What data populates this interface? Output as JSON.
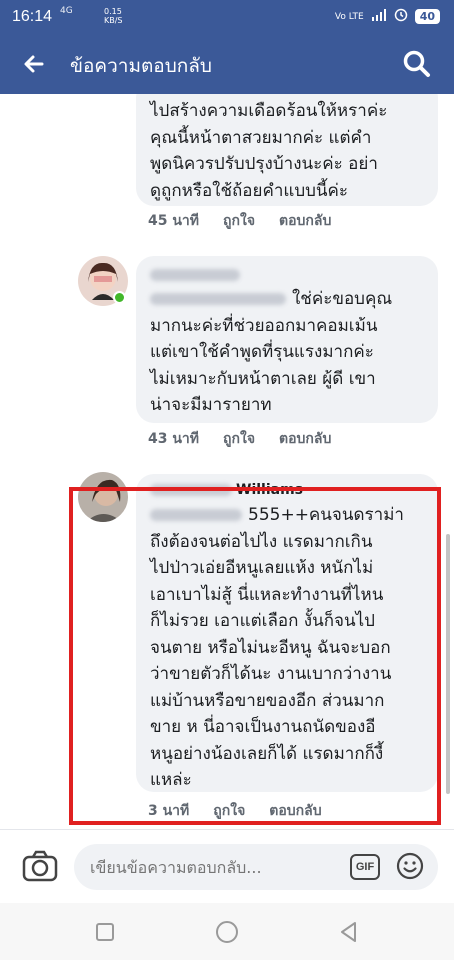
{
  "status": {
    "time": "16:14",
    "network": "4G",
    "speed_value": "0.15",
    "speed_unit": "KB/S",
    "volte": "Vo LTE",
    "battery": "40"
  },
  "header": {
    "title": "ข้อความตอบกลับ"
  },
  "comments": [
    {
      "text": "ไปสร้างความเดือดร้อนให้หราค่ะ\nคุณนี้หน้าตาสวยมากค่ะ แต่คำ\nพูดนิควรปรับปรุงบ้างนะค่ะ อย่า\nดูถูกหรือใช้ถ้อยคำแบบนี้ค่ะ",
      "time": "45 นาที",
      "like": "ถูกใจ",
      "reply": "ตอบกลับ"
    },
    {
      "text": "ใช่ค่ะขอบคุณ\nมากนะค่ะที่ช่วยออกมาคอมเม้น\nแต่เขาใช้คำพูดที่รุนแรงมากค่ะ\nไม่เหมาะกับหน้าตาเลย  ผู้ดี เขา\nน่าจะมีมารายาท",
      "time": "43 นาที",
      "like": "ถูกใจ",
      "reply": "ตอบกลับ"
    },
    {
      "name_suffix": "Williams",
      "text": "555++คนจนดราม่า\nถึงต้องจนต่อไปไง  แรดมากเกิน\nไปป่าวเอ่ยอีหนูเลยแห้ง หนักไม่\nเอาเบาไม่สู้ นี่แหละทำงานที่ไหน\nก็ไม่รวย เอาแต่เลือก งั้นก็จนไป\nจนตาย หรือไม่นะอีหนู ฉันจะบอก\nว่าขายตัวก็ได้นะ  งานเบากว่างาน\nแม่บ้านหรือขายของอีก ส่วนมาก\nขาย ห นี่อาจเป็นงานถนัดของอี\nหนูอย่างน้องเลยก็ได้ แรดมากก็งี้\nแหล่ะ",
      "time": "3 นาที",
      "like": "ถูกใจ",
      "reply": "ตอบกลับ"
    }
  ],
  "composer": {
    "placeholder": "เขียนข้อความตอบกลับ...",
    "gif": "GIF"
  },
  "icons": {
    "back": "arrow-left-icon",
    "search": "search-icon",
    "camera": "camera-icon",
    "emoji": "smiley-icon",
    "nav": [
      "square-icon",
      "circle-icon",
      "triangle-back-icon"
    ]
  },
  "colors": {
    "brand": "#3b5998",
    "highlight": "#e02020",
    "bubble": "#f0f2f5",
    "online": "#42b72a"
  }
}
